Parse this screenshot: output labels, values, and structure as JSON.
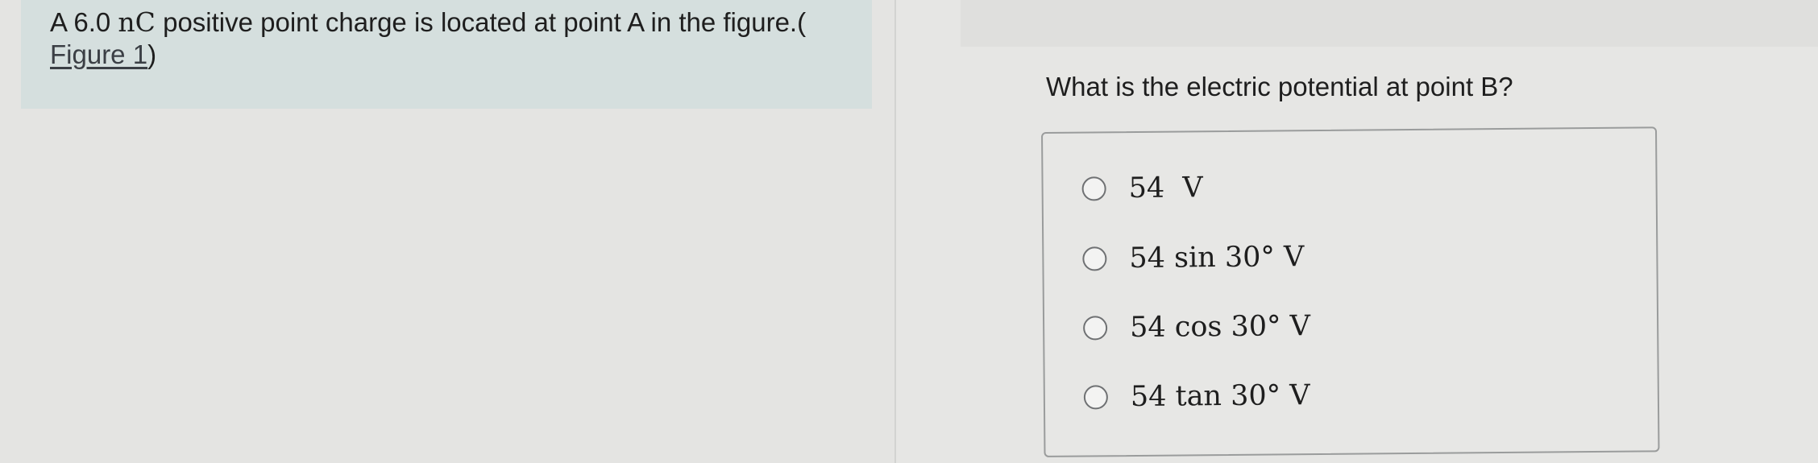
{
  "problem": {
    "intro_prefix": "A 6.0 ",
    "intro_unit": "nC",
    "intro_suffix": " positive point charge is located at point A in the figure.(",
    "figure_link": "Figure 1",
    "figure_link_close": ")"
  },
  "question": {
    "text": "What is the electric potential at point B?"
  },
  "answers": {
    "options": [
      {
        "label": "54  V",
        "selected": false
      },
      {
        "label": "54 sin 30° V",
        "selected": false
      },
      {
        "label": "54 cos 30° V",
        "selected": false
      },
      {
        "label": "54 tan 30° V",
        "selected": false
      }
    ]
  }
}
